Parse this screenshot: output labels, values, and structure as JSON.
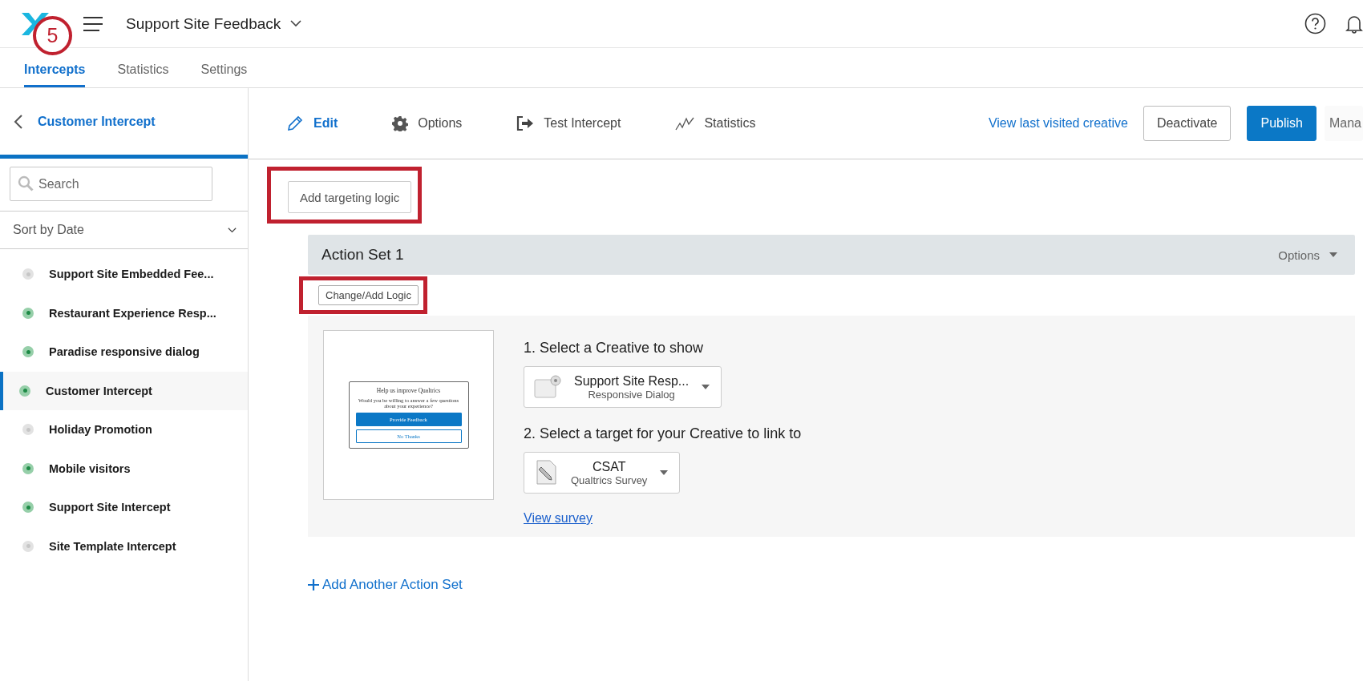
{
  "annotation": {
    "step": "5"
  },
  "header": {
    "title": "Support Site Feedback"
  },
  "tabs": [
    {
      "label": "Intercepts",
      "selected": true
    },
    {
      "label": "Statistics",
      "selected": false
    },
    {
      "label": "Settings",
      "selected": false
    }
  ],
  "sidebar": {
    "back_label": "Customer Intercept",
    "search": {
      "placeholder": "Search"
    },
    "sort": "Sort by Date",
    "items": [
      {
        "label": "Support Site Embedded Fee...",
        "active": false,
        "selected": false
      },
      {
        "label": "Restaurant Experience Resp...",
        "active": true,
        "selected": false
      },
      {
        "label": "Paradise responsive dialog",
        "active": true,
        "selected": false
      },
      {
        "label": "Customer Intercept",
        "active": true,
        "selected": true
      },
      {
        "label": "Holiday Promotion",
        "active": false,
        "selected": false
      },
      {
        "label": "Mobile visitors",
        "active": true,
        "selected": false
      },
      {
        "label": "Support Site Intercept",
        "active": true,
        "selected": false
      },
      {
        "label": "Site Template Intercept",
        "active": false,
        "selected": false
      }
    ]
  },
  "toolbar": {
    "items": [
      {
        "label": "Edit",
        "kind": "pencil",
        "selected": true
      },
      {
        "label": "Options",
        "kind": "gear",
        "selected": false
      },
      {
        "label": "Test Intercept",
        "kind": "exit",
        "selected": false
      },
      {
        "label": "Statistics",
        "kind": "chart",
        "selected": false
      }
    ],
    "link": "View last visited creative",
    "buttons": [
      {
        "label": "Deactivate",
        "kind": "secondary"
      },
      {
        "label": "Publish",
        "kind": "primary"
      },
      {
        "label": "Mana",
        "kind": "plain"
      }
    ]
  },
  "targeting": {
    "label": "Add targeting logic",
    "highlighted": true
  },
  "action_set": {
    "title": "Action Set 1",
    "options": "Options",
    "logic": {
      "label": "Change/Add Logic",
      "highlighted": true
    },
    "preview": {
      "title": "Help us improve Qualtrics",
      "body": "Would you be willing to answer a few questions about your experience?",
      "buttons": [
        "Provide Feedback",
        "No Thanks"
      ]
    },
    "steps": [
      {
        "heading": "1. Select a Creative to show",
        "select": {
          "title": "Support Site Resp...",
          "subtitle": "Responsive Dialog",
          "kind": "dialog"
        }
      },
      {
        "heading": "2. Select a target for your Creative to link to",
        "select": {
          "title": "CSAT",
          "subtitle": "Qualtrics Survey",
          "kind": "survey"
        },
        "link": "View survey"
      }
    ]
  },
  "add_action_set": "Add Another Action Set"
}
